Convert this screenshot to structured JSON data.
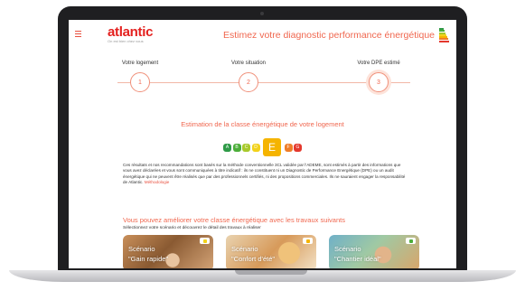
{
  "header": {
    "logo": "atlantic",
    "logo_tagline": "On est bien chez vous",
    "title": "Estimez votre diagnostic performance énergétique"
  },
  "steps": [
    {
      "label": "Votre logement",
      "number": "1"
    },
    {
      "label": "Votre situation",
      "number": "2"
    },
    {
      "label": "Votre DPE estimé",
      "number": "3"
    }
  ],
  "estimation": {
    "title": "Estimation de la classe énergétique de votre logement",
    "classes": [
      {
        "letter": "A",
        "color": "#2e9a47"
      },
      {
        "letter": "B",
        "color": "#4cae3a"
      },
      {
        "letter": "C",
        "color": "#a8c92c"
      },
      {
        "letter": "D",
        "color": "#f2d21b"
      },
      {
        "letter": "E",
        "color": "#f5b400",
        "selected": true
      },
      {
        "letter": "F",
        "color": "#ef7d29"
      },
      {
        "letter": "G",
        "color": "#e4382d"
      }
    ],
    "disclaimer": "Ces résultats et nos recommandations sont basés sur la méthode conventionnelle 3CL validée par l'ADEME, sont estimés à partir des informations que vous avez déclarées et vous sont communiquées à titre indicatif : ils ne constituent ni un Diagnostic de Performance Energétique (DPE) ou un audit énergétique qui ne peuvent être réalisés que par des professionnels certifiés, ni des propositions commerciales. Ils ne sauraient engager la responsabilité de Atlantic.",
    "method_link": "Méthodologie"
  },
  "improve": {
    "title": "Vous pouvez améliorer votre classe énergétique avec les travaux suivants",
    "subtitle": "Sélectionnez votre scénario et découvrez le détail des travaux à réaliser",
    "cards": [
      {
        "line1": "Scénario",
        "line2": "\"Gain rapide\""
      },
      {
        "line1": "Scénario",
        "line2": "\"Confort d'été\""
      },
      {
        "line1": "Scénario",
        "line2": "\"Chantier idéal\""
      }
    ]
  },
  "colors": {
    "brand_red": "#e4201e",
    "accent_orange": "#f0674f"
  }
}
